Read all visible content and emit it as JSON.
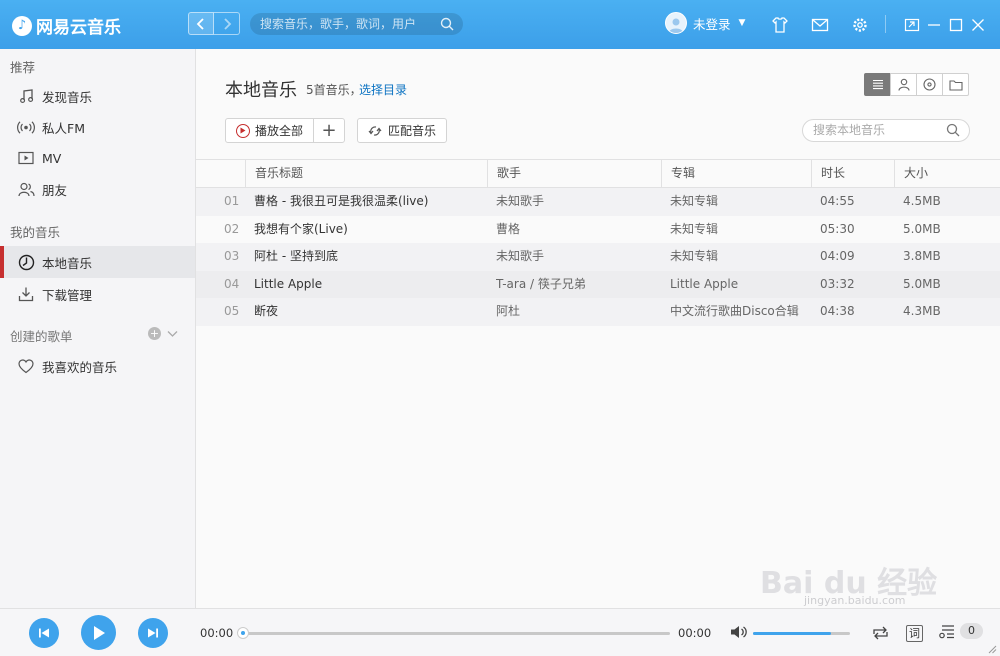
{
  "app": {
    "title": "网易云音乐",
    "colors": {
      "accent": "#3fa3ec",
      "active_marker": "#c62f2f",
      "link": "#0c73c2"
    }
  },
  "titlebar": {
    "search_placeholder": "搜索音乐，歌手，歌词，用户",
    "user_label": "未登录",
    "icons": [
      "skin-icon",
      "mail-icon",
      "settings-icon",
      "mini-mode-icon",
      "minimize-icon",
      "maximize-icon",
      "close-icon"
    ]
  },
  "sidebar": {
    "recommend_header": "推荐",
    "recommend_items": [
      {
        "label": "发现音乐",
        "icon": "music-note-icon"
      },
      {
        "label": "私人FM",
        "icon": "radio-icon"
      },
      {
        "label": "MV",
        "icon": "video-icon"
      },
      {
        "label": "朋友",
        "icon": "friends-icon"
      }
    ],
    "my_music_header": "我的音乐",
    "my_music_items": [
      {
        "label": "本地音乐",
        "icon": "clock-icon",
        "active": true
      },
      {
        "label": "下载管理",
        "icon": "download-icon",
        "active": false
      }
    ],
    "created_header": "创建的歌单",
    "created_items": [
      {
        "label": "我喜欢的音乐",
        "icon": "heart-icon"
      }
    ]
  },
  "main": {
    "title": "本地音乐",
    "song_count": "5首音乐，",
    "choose_dir": "选择目录",
    "play_all": "播放全部",
    "add_label": "+",
    "match_music": "匹配音乐",
    "local_search_placeholder": "搜索本地音乐",
    "view_modes": [
      "list-view-icon",
      "artist-view-icon",
      "album-view-icon",
      "folder-view-icon"
    ],
    "columns": [
      "音乐标题",
      "歌手",
      "专辑",
      "时长",
      "大小"
    ],
    "rows": [
      {
        "num": "01",
        "title": "曹格 - 我很丑可是我很温柔(live)",
        "artist": "未知歌手",
        "album": "未知专辑",
        "duration": "04:55",
        "size": "4.5MB"
      },
      {
        "num": "02",
        "title": "我想有个家(Live)",
        "artist": "曹格",
        "album": "未知专辑",
        "duration": "05:30",
        "size": "5.0MB"
      },
      {
        "num": "03",
        "title": "阿杜 - 坚持到底",
        "artist": "未知歌手",
        "album": "未知专辑",
        "duration": "04:09",
        "size": "3.8MB"
      },
      {
        "num": "04",
        "title": "Little Apple",
        "artist": "T-ara / 筷子兄弟",
        "album": "Little Apple",
        "duration": "03:32",
        "size": "5.0MB"
      },
      {
        "num": "05",
        "title": "断夜",
        "artist": "阿杜",
        "album": "中文流行歌曲Disco合辑",
        "duration": "04:38",
        "size": "4.3MB"
      }
    ]
  },
  "player": {
    "current_time": "00:00",
    "total_time": "00:00",
    "progress": 0,
    "volume": 0.8,
    "lyric_label": "词",
    "queue_count": "0"
  },
  "watermark": {
    "brand": "Bai du 经验",
    "url": "jingyan.baidu.com"
  }
}
